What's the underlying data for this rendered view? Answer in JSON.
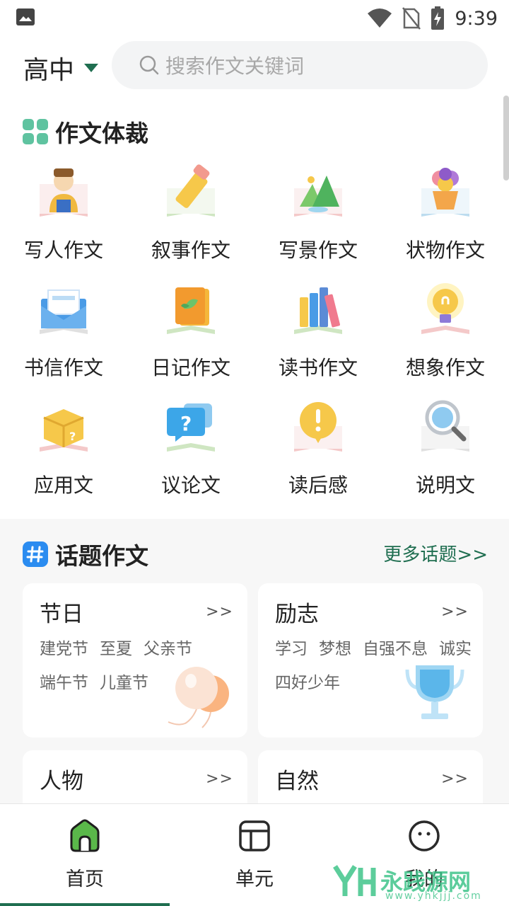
{
  "status_bar": {
    "time": "9:39"
  },
  "header": {
    "grade": "高中",
    "search_placeholder": "搜索作文关键词"
  },
  "genres_section": {
    "title": "作文体裁",
    "items": [
      {
        "label": "写人作文",
        "icon": "person-icon"
      },
      {
        "label": "叙事作文",
        "icon": "pencil-icon"
      },
      {
        "label": "写景作文",
        "icon": "mountain-icon"
      },
      {
        "label": "状物作文",
        "icon": "flower-pot-icon"
      },
      {
        "label": "书信作文",
        "icon": "envelope-icon"
      },
      {
        "label": "日记作文",
        "icon": "notebook-icon"
      },
      {
        "label": "读书作文",
        "icon": "books-icon"
      },
      {
        "label": "想象作文",
        "icon": "lightbulb-icon"
      },
      {
        "label": "应用文",
        "icon": "box-icon"
      },
      {
        "label": "议论文",
        "icon": "question-bubble-icon"
      },
      {
        "label": "读后感",
        "icon": "exclamation-bubble-icon"
      },
      {
        "label": "说明文",
        "icon": "magnifier-icon"
      }
    ]
  },
  "topics_section": {
    "title": "话题作文",
    "more_label": "更多话题>>",
    "cards": [
      {
        "title": "节日",
        "more": ">>",
        "tags": [
          "建党节",
          "至夏",
          "父亲节",
          "端午节",
          "儿童节"
        ],
        "deco": "balloon-icon"
      },
      {
        "title": "励志",
        "more": ">>",
        "tags": [
          "学习",
          "梦想",
          "自强不息",
          "诚实",
          "四好少年"
        ],
        "deco": "trophy-icon"
      },
      {
        "title": "人物",
        "more": ">>",
        "tags": []
      },
      {
        "title": "自然",
        "more": ">>",
        "tags": []
      }
    ]
  },
  "bottom_nav": {
    "items": [
      {
        "label": "首页",
        "icon": "home-icon",
        "active": true
      },
      {
        "label": "单元",
        "icon": "layout-icon",
        "active": false
      },
      {
        "label": "我的",
        "icon": "smile-icon",
        "active": false
      }
    ]
  },
  "watermark": {
    "text": "永践源网",
    "sub": "www.yhkjjj.com"
  },
  "colors": {
    "accent": "#1f6e50",
    "section_icon": "#5fc3a0",
    "topic_icon": "#2b8cf0"
  }
}
